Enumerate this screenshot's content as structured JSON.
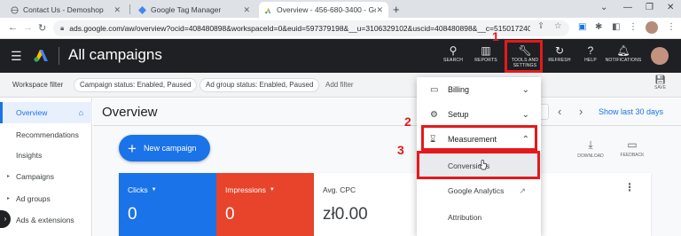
{
  "browser": {
    "tabs": [
      {
        "title": "Contact Us - Demoshop"
      },
      {
        "title": "Google Tag Manager"
      },
      {
        "title": "Overview - 456-680-3400 - Goo"
      }
    ],
    "new_tab": "+",
    "window_controls": {
      "minimize": "—",
      "restore": "❐",
      "close": "✕"
    },
    "url": "ads.google.com/aw/overview?ocid=408480898&workspaceId=0&euid=597379198&__u=3106329102&uscid=408480898&__c=5150172402&a..."
  },
  "header": {
    "title": "All campaigns",
    "buttons": [
      {
        "label": "SEARCH",
        "icon": "search-icon"
      },
      {
        "label": "REPORTS",
        "icon": "reports-icon"
      },
      {
        "label": "TOOLS AND SETTINGS",
        "icon": "wrench-icon"
      },
      {
        "label": "REFRESH",
        "icon": "refresh-icon"
      },
      {
        "label": "HELP",
        "icon": "help-icon"
      },
      {
        "label": "NOTIFICATIONS",
        "icon": "bell-icon"
      }
    ]
  },
  "filterbar": {
    "workspace_filter": "Workspace filter",
    "chips": [
      "Campaign status: Enabled, Paused",
      "Ad group status: Enabled, Paused"
    ],
    "add_filter": "Add filter",
    "save_label": "SAVE"
  },
  "sidebar": {
    "items": [
      {
        "label": "Overview"
      },
      {
        "label": "Recommendations"
      },
      {
        "label": "Insights"
      },
      {
        "label": "Campaigns"
      },
      {
        "label": "Ad groups"
      },
      {
        "label": "Ads & extensions"
      }
    ]
  },
  "main": {
    "title": "Overview",
    "date_range": "Show last 30 days",
    "new_campaign": "New campaign",
    "download_label": "DOWNLOAD",
    "feedback_label": "FEEDBACK",
    "metrics": [
      {
        "label": "Clicks",
        "value": "0"
      },
      {
        "label": "Impressions",
        "value": "0"
      },
      {
        "label": "Avg. CPC",
        "value": "zł0.00"
      }
    ]
  },
  "tools_menu": {
    "sections": [
      {
        "label": "Billing",
        "icon": "billing-icon"
      },
      {
        "label": "Setup",
        "icon": "setup-icon"
      },
      {
        "label": "Measurement",
        "icon": "hourglass-icon"
      }
    ],
    "measurement_items": [
      {
        "label": "Conversions"
      },
      {
        "label": "Google Analytics"
      },
      {
        "label": "Attribution"
      }
    ]
  },
  "annotations": {
    "step1": "1",
    "step2": "2",
    "step3": "3"
  },
  "colors": {
    "accent": "#1a73e8",
    "impressions": "#e8432b",
    "annotation": "#e5191c",
    "header": "#1f2023"
  }
}
